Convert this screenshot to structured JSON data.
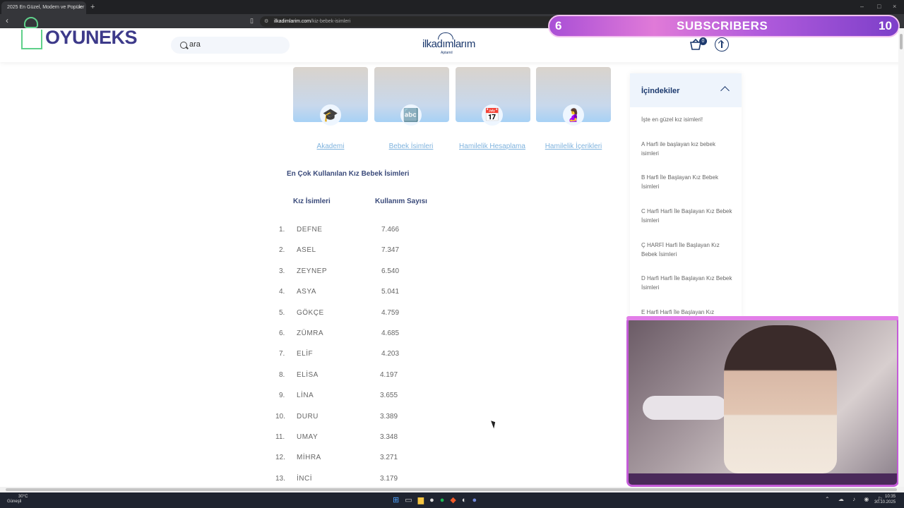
{
  "browser": {
    "tab_title": "2025 En Güzel, Modern ve Popüler",
    "tab_close": "×",
    "new_tab": "+",
    "url_domain": "ilkadimlarim.com",
    "url_path": "/kiz-bebek-isimleri"
  },
  "overlay": {
    "logo_text": "OYUNEKS",
    "subscribers_left": "6",
    "subscribers_label": "SUBSCRIBERS",
    "subscribers_right": "10"
  },
  "header": {
    "search_placeholder": "ara",
    "brand": "ilkadımlarım",
    "brand_sub": "Aptamil",
    "cart_count": "0"
  },
  "cards": [
    {
      "label": "Akademi",
      "icon": "graduation-cap-icon",
      "glyph": "🎓"
    },
    {
      "label": "Bebek İsimleri",
      "icon": "abc-blocks-icon",
      "glyph": "🔤"
    },
    {
      "label": "Hamilelik Hesaplama",
      "icon": "calendar-icon",
      "glyph": "📅"
    },
    {
      "label": "Hamilelik İçerikleri",
      "icon": "pregnancy-icon",
      "glyph": "🤰"
    }
  ],
  "table": {
    "heading": "En Çok Kullanılan Kız Bebek İsimleri",
    "col_name": "Kız İsimleri",
    "col_count": "Kullanım Sayısı",
    "rows": [
      {
        "n": "1.",
        "name": "DEFNE",
        "count": "7.466"
      },
      {
        "n": "2.",
        "name": "ASEL",
        "count": "7.347"
      },
      {
        "n": "3.",
        "name": "ZEYNEP",
        "count": "6.540"
      },
      {
        "n": "4.",
        "name": "ASYA",
        "count": "5.041"
      },
      {
        "n": "5.",
        "name": "GÖKÇE",
        "count": "4.759"
      },
      {
        "n": "6.",
        "name": "ZÜMRA",
        "count": "4.685"
      },
      {
        "n": "7.",
        "name": "ELİF",
        "count": "4.203"
      },
      {
        "n": "8.",
        "name": "ELİSA",
        "count": "4.197"
      },
      {
        "n": "9.",
        "name": "LİNA",
        "count": "3.655"
      },
      {
        "n": "10.",
        "name": "DURU",
        "count": "3.389"
      },
      {
        "n": "11.",
        "name": "UMAY",
        "count": "3.348"
      },
      {
        "n": "12.",
        "name": "MİHRA",
        "count": "3.271"
      },
      {
        "n": "13.",
        "name": "İNCİ",
        "count": "3.179"
      }
    ]
  },
  "toc": {
    "title": "İçindekiler",
    "items": [
      "İşte en güzel kız isimleri!",
      "A Harfi ile başlayan kız bebek isimleri",
      "B Harfi İle Başlayan Kız Bebek İsimleri",
      "C Harfi Harfi İle Başlayan Kız Bebek İsimleri",
      "Ç HARFİ Harfi İle Başlayan Kız Bebek İsimleri",
      "D Harfi Harfi İle Başlayan Kız Bebek İsimleri",
      "E Harfi Harfi İle Başlayan Kız"
    ]
  },
  "taskbar": {
    "weather_temp": "30°C",
    "weather_desc": "Güneşli",
    "time": "10:35",
    "date": "30.10.2025"
  }
}
